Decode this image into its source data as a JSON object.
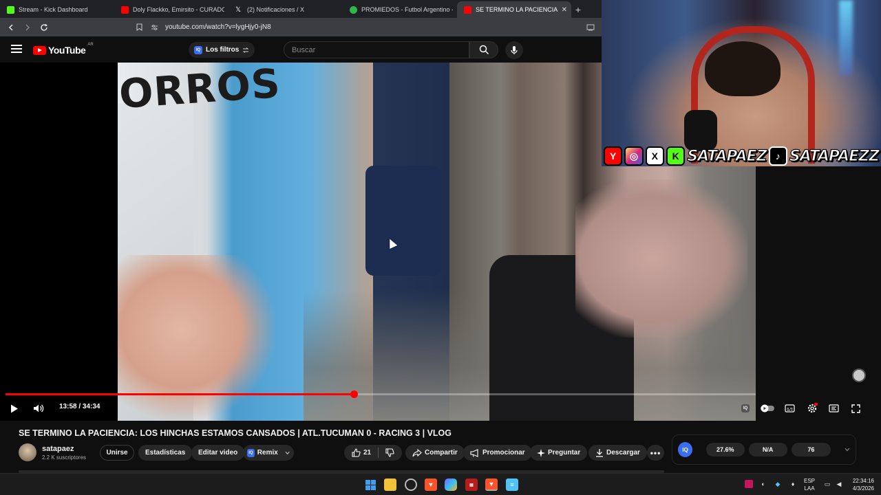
{
  "browser": {
    "tabs": [
      {
        "label": "Stream - Kick Dashboard",
        "color": "#53fc18"
      },
      {
        "label": "Doly Flackko, Emirsito - CURADO DE",
        "color": "#ff0000"
      },
      {
        "label": "(2) Notificaciones / X",
        "color": "#ffffff"
      },
      {
        "label": "PROMIEDOS - Futbol Argentino - Fix",
        "color": "#2db84a"
      },
      {
        "label": "SE TERMINO LA PACIENCIA: LOS",
        "color": "#ff0000",
        "active": true
      }
    ],
    "url": "youtube.com/watch?v=lygHjy0-jN8"
  },
  "youtube": {
    "logo_text": "YouTube",
    "country": "AR",
    "filters_label": "Los filtros",
    "search_placeholder": "Buscar"
  },
  "overlay": {
    "handle_kick": "SATAPAEZ",
    "handle_tiktok": "SATAPAEZZ",
    "icons": {
      "youtube": "Y",
      "instagram": "◎",
      "x": "X",
      "kick": "K",
      "tiktok": "♪"
    }
  },
  "player": {
    "time_current": "13:58",
    "time_total": "34:34",
    "time_display": "13:58 / 34:34",
    "progress": 0.4642,
    "accent": "#ff0000"
  },
  "video_info": {
    "title": "SE TERMINO LA PACIENCIA: LOS HINCHAS ESTAMOS CANSADOS | ATL.TUCUMAN 0 - RACING 3 | VLOG",
    "channel": "satapaez",
    "subscribers": "2.2 K suscriptores",
    "buttons": {
      "join": "Unirse",
      "stats": "Estadísticas",
      "edit": "Editar video",
      "remix": "Remix",
      "likes": "21",
      "share": "Compartir",
      "promote": "Promocionar",
      "ask": "Preguntar",
      "download": "Descargar"
    }
  },
  "stats_widget": {
    "badge": "IQ",
    "values": [
      "27.6%",
      "N/A",
      "76"
    ]
  },
  "taskbar": {
    "lang_top": "ESP",
    "lang_bottom": "LAA",
    "time": "22:34:16",
    "date": "4/3/2026"
  }
}
